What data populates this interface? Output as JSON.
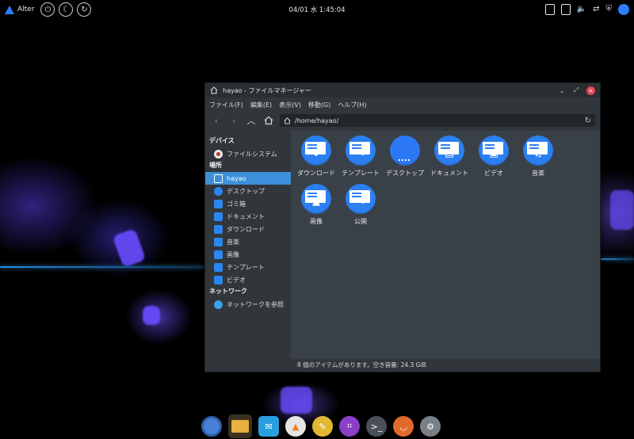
{
  "top_panel": {
    "logo_text": "Alter",
    "clock": "04/01 水  1:45:04",
    "icons": [
      "power-icon",
      "night-mode-icon",
      "refresh-icon"
    ],
    "tray_icons": [
      "clipboard-icon",
      "battery-icon",
      "volume-icon",
      "network-icon",
      "shield-icon",
      "user-avatar"
    ]
  },
  "window": {
    "title": "hayao - ファイルマネージャー",
    "menu": [
      "ファイル(F)",
      "編集(E)",
      "表示(V)",
      "移動(G)",
      "ヘルプ(H)"
    ],
    "address": "/home/hayao/",
    "sidebar": {
      "devices_header": "デバイス",
      "devices": [
        "ファイルシステム"
      ],
      "places_header": "場所",
      "places": [
        "hayao",
        "デスクトップ",
        "ゴミ箱",
        "ドキュメント",
        "ダウンロード",
        "音楽",
        "画像",
        "テンプレート",
        "ビデオ"
      ],
      "network_header": "ネットワーク",
      "network": [
        "ネットワークを参照"
      ]
    },
    "files": [
      {
        "label": "ダウンロード",
        "icon": "download-folder-icon"
      },
      {
        "label": "テンプレート",
        "icon": "templates-folder-icon"
      },
      {
        "label": "デスクトップ",
        "icon": "desktop-folder-icon"
      },
      {
        "label": "ドキュメント",
        "icon": "documents-folder-icon"
      },
      {
        "label": "ビデオ",
        "icon": "videos-folder-icon"
      },
      {
        "label": "音楽",
        "icon": "music-folder-icon"
      },
      {
        "label": "画像",
        "icon": "pictures-folder-icon"
      },
      {
        "label": "公開",
        "icon": "public-folder-icon"
      }
    ],
    "status": "8 個のアイテムがあります。空き容量: 24.3 GiB"
  },
  "dock": [
    "chromium-icon",
    "file-manager-icon",
    "mail-icon",
    "vlc-icon",
    "text-editor-icon",
    "screenshot-icon",
    "terminal-icon",
    "software-center-icon",
    "settings-icon"
  ],
  "colors": {
    "accent": "#2b7ff0",
    "window_bg": "#31363b",
    "content_bg": "#3a4048",
    "selection": "#3e8fd9"
  }
}
